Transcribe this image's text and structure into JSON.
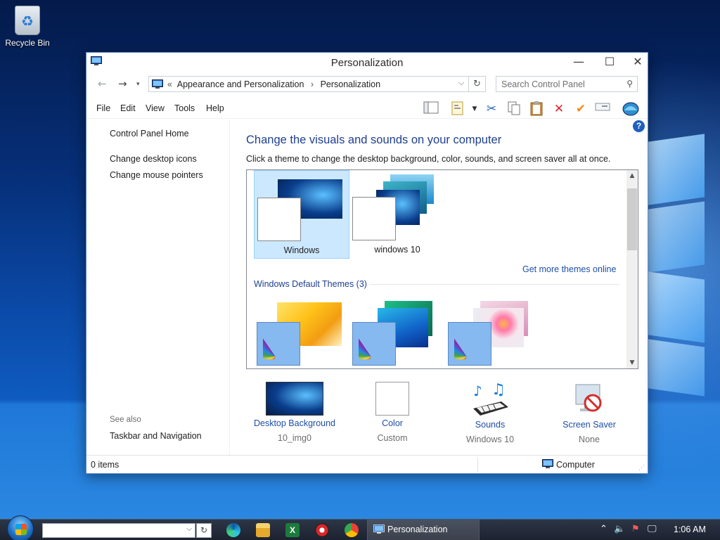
{
  "desktop": {
    "recycle_bin_label": "Recycle Bin"
  },
  "window": {
    "title": "Personalization",
    "address": {
      "overflow": "«",
      "crumbs": [
        "Appearance and Personalization",
        "Personalization"
      ]
    },
    "search_placeholder": "Search Control Panel",
    "menu": [
      "File",
      "Edit",
      "View",
      "Tools",
      "Help"
    ],
    "toolbar_icons": [
      "layout-icon",
      "properties-icon",
      "cut-icon",
      "copy-icon",
      "paste-icon",
      "delete-icon",
      "check-icon",
      "rename-icon",
      "shell-icon"
    ],
    "left_pane": {
      "home": "Control Panel Home",
      "links": [
        "Change desktop icons",
        "Change mouse pointers"
      ],
      "see_also": "See also",
      "see_also_links": [
        "Taskbar and Navigation"
      ]
    },
    "heading": "Change the visuals and sounds on your computer",
    "subtext": "Click a theme to change the desktop background, color, sounds, and screen saver all at once.",
    "my_themes": [
      {
        "name": "Windows",
        "selected": true
      },
      {
        "name": "windows 10",
        "selected": false
      }
    ],
    "get_more": "Get more themes online",
    "default_group_label": "Windows Default Themes (3)",
    "settings": [
      {
        "name": "Desktop Background",
        "value": "10_img0",
        "icon": "desktop-background-icon"
      },
      {
        "name": "Color",
        "value": "Custom",
        "icon": "color-icon"
      },
      {
        "name": "Sounds",
        "value": "Windows 10",
        "icon": "sounds-icon"
      },
      {
        "name": "Screen Saver",
        "value": "None",
        "icon": "screen-saver-icon"
      }
    ],
    "status": {
      "items": "0 items",
      "location": "Computer"
    }
  },
  "taskbar": {
    "active_window": "Personalization",
    "clock": "1:06 AM",
    "pinned": [
      "edge-icon",
      "file-explorer-icon",
      "excel-icon",
      "app-icon",
      "chrome-icon"
    ]
  },
  "colors": {
    "accent_link": "#1e4ea8",
    "heading_blue": "#1e3f90",
    "selection_bg": "#cce8ff"
  }
}
